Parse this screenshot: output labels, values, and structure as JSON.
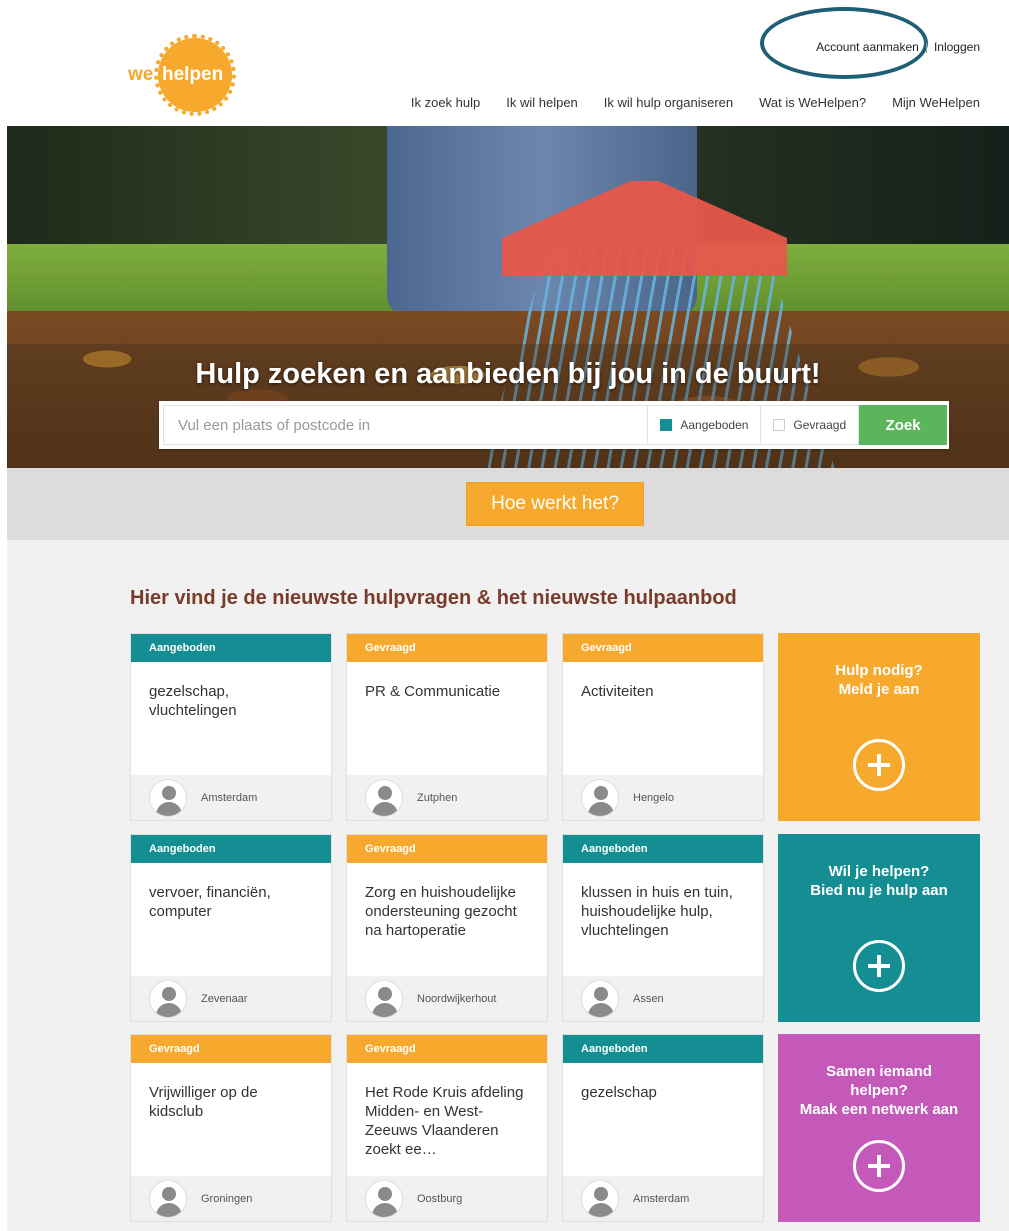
{
  "logo": {
    "we": "we",
    "helpen": "helpen"
  },
  "account": {
    "create": "Account aanmaken",
    "separator": "|",
    "login": "Inloggen"
  },
  "nav": [
    "Ik zoek hulp",
    "Ik wil helpen",
    "Ik wil hulp organiseren",
    "Wat is WeHelpen?",
    "Mijn WeHelpen"
  ],
  "hero": {
    "title": "Hulp zoeken en aanbieden bij jou in de buurt!"
  },
  "search": {
    "placeholder": "Vul een plaats of postcode in",
    "value": "",
    "option_offered": "Aangeboden",
    "option_offered_checked": true,
    "option_requested": "Gevraagd",
    "option_requested_checked": false,
    "button": "Zoek"
  },
  "how": {
    "button": "Hoe werkt het?"
  },
  "section": {
    "title": "Hier vind je de nieuwste hulpvragen & het nieuwste hulpaanbod"
  },
  "cards": [
    {
      "type": "aangeboden",
      "label": "Aangeboden",
      "title": "gezelschap, vluchtelingen",
      "city": "Amsterdam"
    },
    {
      "type": "gevraagd",
      "label": "Gevraagd",
      "title": "PR & Communicatie",
      "city": "Zutphen"
    },
    {
      "type": "gevraagd",
      "label": "Gevraagd",
      "title": "Activiteiten",
      "city": "Hengelo"
    },
    {
      "type": "aangeboden",
      "label": "Aangeboden",
      "title": "vervoer, financiën, computer",
      "city": "Zevenaar"
    },
    {
      "type": "gevraagd",
      "label": "Gevraagd",
      "title": "Zorg en huishoudelijke ondersteuning gezocht na hartoperatie",
      "city": "Noordwijkerhout"
    },
    {
      "type": "aangeboden",
      "label": "Aangeboden",
      "title": "klussen in huis en tuin, huishoudelijke hulp, vluchtelingen",
      "city": "Assen"
    },
    {
      "type": "gevraagd",
      "label": "Gevraagd",
      "title": "Vrijwilliger op de kidsclub",
      "city": "Groningen"
    },
    {
      "type": "gevraagd",
      "label": "Gevraagd",
      "title": "Het Rode Kruis afdeling Midden- en West- Zeeuws Vlaanderen zoekt ee…",
      "city": "Oostburg"
    },
    {
      "type": "aangeboden",
      "label": "Aangeboden",
      "title": "gezelschap",
      "city": "Amsterdam"
    }
  ],
  "cta": [
    {
      "color": "orange",
      "line1": "Hulp nodig?",
      "line2": "Meld je aan",
      "line3": ""
    },
    {
      "color": "teal",
      "line1": "Wil je helpen?",
      "line2": "Bied nu je hulp aan",
      "line3": ""
    },
    {
      "color": "pink",
      "line1": "Samen iemand",
      "line2": "helpen?",
      "line3": "Maak een netwerk aan"
    }
  ],
  "colors": {
    "teal": "#158e93",
    "orange": "#f7a92d",
    "pink": "#c559ba",
    "green": "#5bb65b",
    "title": "#7a3b2b"
  }
}
